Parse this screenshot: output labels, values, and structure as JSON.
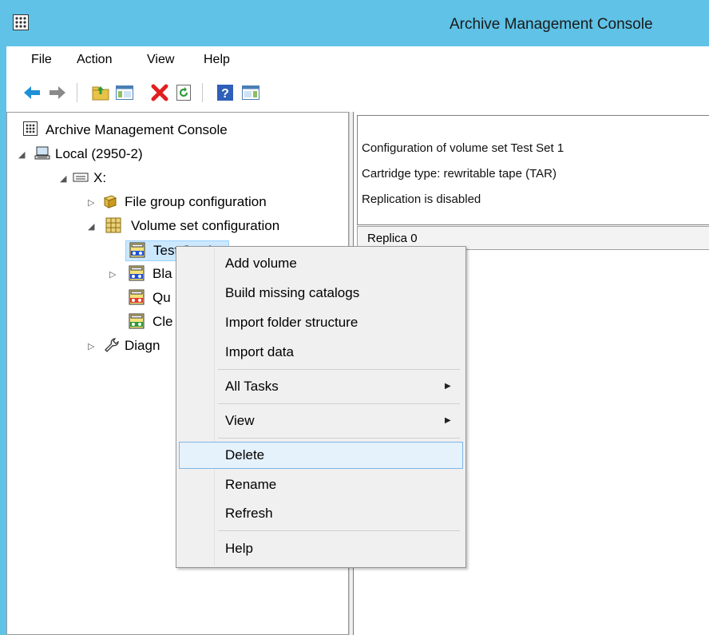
{
  "window": {
    "title": "Archive Management Console"
  },
  "menu": {
    "file": "File",
    "action": "Action",
    "view": "View",
    "help": "Help"
  },
  "toolbar": {
    "buttons": [
      "back-arrow-icon",
      "forward-arrow-icon",
      "up-folder-icon",
      "show-hide-tree-icon",
      "delete-x-icon",
      "refresh-icon",
      "help-icon",
      "properties-pane-icon"
    ]
  },
  "tree": {
    "root": "Archive Management Console",
    "local": "Local (2950-2)",
    "drive": "X:",
    "file_group": "File group configuration",
    "volume_set": "Volume set configuration",
    "item_test_set": "Test Set 1",
    "item_bla": "Bla",
    "item_qu": "Qu",
    "item_cle": "Cle",
    "diagnostics": "Diagn"
  },
  "result": {
    "lines": [
      "Configuration of volume set Test Set 1",
      "Cartridge type: rewritable tape (TAR)",
      "Replication is disabled"
    ],
    "replica_header": "Replica 0"
  },
  "context_menu": {
    "items": [
      {
        "label": "Add volume"
      },
      {
        "label": "Build missing catalogs"
      },
      {
        "label": "Import folder structure"
      },
      {
        "label": "Import data"
      },
      {
        "label": "All Tasks"
      },
      {
        "label": "View"
      },
      {
        "label": "Delete"
      },
      {
        "label": "Rename"
      },
      {
        "label": "Refresh"
      },
      {
        "label": "Help"
      }
    ],
    "highlighted": "Delete",
    "submenu_arrow": "▶"
  }
}
